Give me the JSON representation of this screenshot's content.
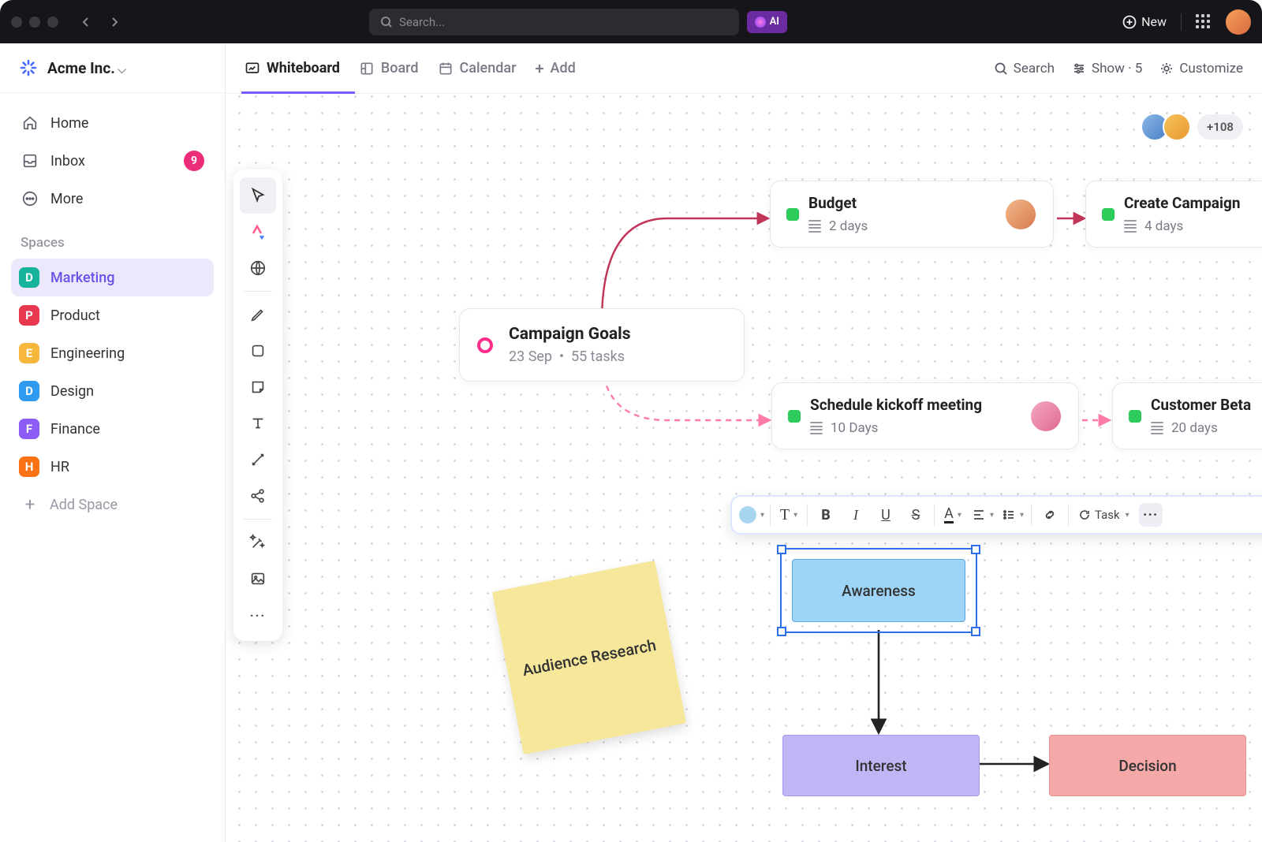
{
  "titlebar": {
    "search_placeholder": "Search...",
    "ai_label": "AI",
    "new_label": "New"
  },
  "workspace": {
    "name": "Acme Inc."
  },
  "nav": {
    "home": "Home",
    "inbox": "Inbox",
    "inbox_badge": "9",
    "more": "More"
  },
  "spaces_label": "Spaces",
  "spaces": [
    {
      "letter": "D",
      "name": "Marketing",
      "color": "#17b39b",
      "active": true
    },
    {
      "letter": "P",
      "name": "Product",
      "color": "#e8384f",
      "active": false
    },
    {
      "letter": "E",
      "name": "Engineering",
      "color": "#f6b73c",
      "active": false
    },
    {
      "letter": "D",
      "name": "Design",
      "color": "#2e9bf0",
      "active": false
    },
    {
      "letter": "F",
      "name": "Finance",
      "color": "#8b5cf6",
      "active": false
    },
    {
      "letter": "H",
      "name": "HR",
      "color": "#f97316",
      "active": false
    }
  ],
  "add_space": "Add Space",
  "tabs": {
    "whiteboard": "Whiteboard",
    "board": "Board",
    "calendar": "Calendar",
    "add": "Add"
  },
  "viewbar": {
    "search": "Search",
    "show": "Show · 5",
    "customize": "Customize"
  },
  "presence_more": "+108",
  "goal": {
    "title": "Campaign Goals",
    "date": "23 Sep",
    "tasks": "55 tasks"
  },
  "cards": {
    "budget": {
      "title": "Budget",
      "meta": "2 days"
    },
    "campaign": {
      "title": "Create Campaign",
      "meta": "4 days"
    },
    "kickoff": {
      "title": "Schedule kickoff meeting",
      "meta": "10 Days"
    },
    "beta": {
      "title": "Customer Beta",
      "meta": "20 days"
    }
  },
  "sticky": {
    "text": "Audience Research"
  },
  "shapes": {
    "awareness": "Awareness",
    "interest": "Interest",
    "decision": "Decision"
  },
  "fmtbar": {
    "task": "Task"
  },
  "colors": {
    "accent": "#7a5cff",
    "pink": "#ff2d8a",
    "status_green": "#2ecc5a"
  }
}
